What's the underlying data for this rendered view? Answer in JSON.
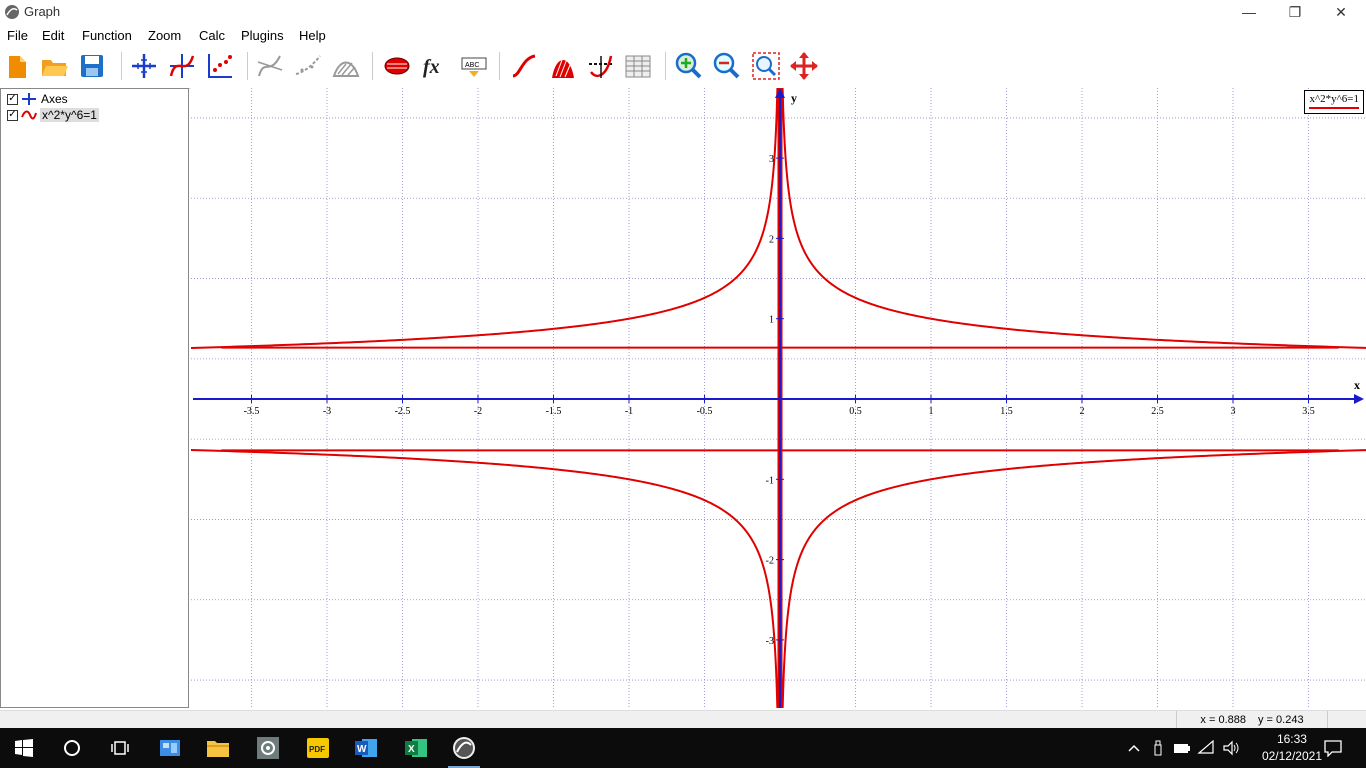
{
  "window": {
    "title": "Graph",
    "minimize": "—",
    "restore": "❐",
    "close": "✕"
  },
  "menu": [
    "File",
    "Edit",
    "Function",
    "Zoom",
    "Calc",
    "Plugins",
    "Help"
  ],
  "toolbar": [
    {
      "name": "new-icon"
    },
    {
      "name": "open-icon"
    },
    {
      "name": "save-icon"
    },
    {
      "name": "axes-icon"
    },
    {
      "name": "insert-function-icon"
    },
    {
      "name": "insert-point-series-icon"
    },
    {
      "name": "insert-tangent-icon"
    },
    {
      "name": "insert-trendline-icon"
    },
    {
      "name": "insert-shading-icon"
    },
    {
      "name": "insert-relation-icon"
    },
    {
      "name": "custom-functions-icon"
    },
    {
      "name": "insert-label-icon"
    },
    {
      "name": "edit-function-icon"
    },
    {
      "name": "area-icon"
    },
    {
      "name": "evaluate-icon"
    },
    {
      "name": "table-icon"
    },
    {
      "name": "zoom-in-icon"
    },
    {
      "name": "zoom-out-icon"
    },
    {
      "name": "zoom-window-icon"
    },
    {
      "name": "move-icon"
    }
  ],
  "sidebar": {
    "items": [
      {
        "label": "Axes",
        "checked": "✓"
      },
      {
        "label": "x^2*y^6=1",
        "checked": "✓"
      }
    ]
  },
  "legend": {
    "label": "x^2*y^6=1",
    "color": "#e00000"
  },
  "chart_data": {
    "type": "line",
    "title": "",
    "xlabel": "x",
    "ylabel": "y",
    "xlim": [
      -3.9,
      3.9
    ],
    "ylim": [
      -3.85,
      3.85
    ],
    "grid": true,
    "legend_placement": "top-right",
    "x_ticks": [
      "-3.5",
      "-3",
      "-2.5",
      "-2",
      "-1.5",
      "-1",
      "-0.5",
      "0.5",
      "1",
      "1.5",
      "2",
      "2.5",
      "3",
      "3.5"
    ],
    "x_tick_values": [
      -3.5,
      -3,
      -2.5,
      -2,
      -1.5,
      -1,
      -0.5,
      0.5,
      1,
      1.5,
      2,
      2.5,
      3,
      3.5
    ],
    "y_ticks": [
      "3",
      "2",
      "1",
      "-1",
      "-2",
      "-3"
    ],
    "y_tick_values": [
      3,
      2,
      1,
      -1,
      -2,
      -3
    ],
    "series": [
      {
        "name": "x^2*y^6=1",
        "relation": "x^2*y^6=1",
        "color": "#e00000"
      }
    ],
    "artifact_lines_y": [
      0.64,
      -0.64
    ]
  },
  "status": {
    "x": "x = 0.888",
    "y": "y = 0.243"
  },
  "taskbar": {
    "time": "16:33",
    "date": "02/12/2021"
  }
}
